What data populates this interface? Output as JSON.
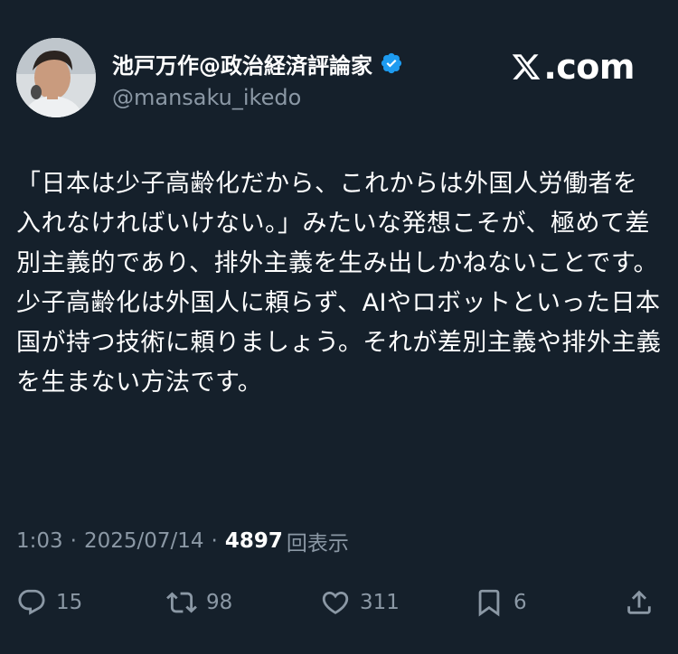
{
  "author": {
    "display_name": "池戸万作@政治経済評論家",
    "handle": "@mansaku_ikedo",
    "verified_icon": "verified-badge-icon",
    "verified_color": "#1d9bf0"
  },
  "brand": {
    "label": ".com",
    "icon": "x-logo-icon"
  },
  "tweet": {
    "text": "「日本は少子高齢化だから、これからは外国人労働者を入れなければいけない。」みたいな発想こそが、極めて差別主義的であり、排外主義を生み出しかねないことです。少子高齢化は外国人に頼らず、AIやロボットといった日本国が持つ技術に頼りましょう。それが差別主義や排外主義を生まない方法です。"
  },
  "meta": {
    "time": "1:03",
    "dot": "·",
    "date": "2025/07/14",
    "views_count": "4897",
    "views_label": "回表示"
  },
  "actions": {
    "reply": {
      "icon": "reply-icon",
      "count": "15"
    },
    "retweet": {
      "icon": "retweet-icon",
      "count": "98"
    },
    "like": {
      "icon": "heart-icon",
      "count": "311"
    },
    "bookmark": {
      "icon": "bookmark-icon",
      "count": "6"
    },
    "share": {
      "icon": "share-icon"
    }
  },
  "colors": {
    "background": "#15202b",
    "secondary_text": "#8b98a5",
    "primary_text": "#ffffff"
  }
}
